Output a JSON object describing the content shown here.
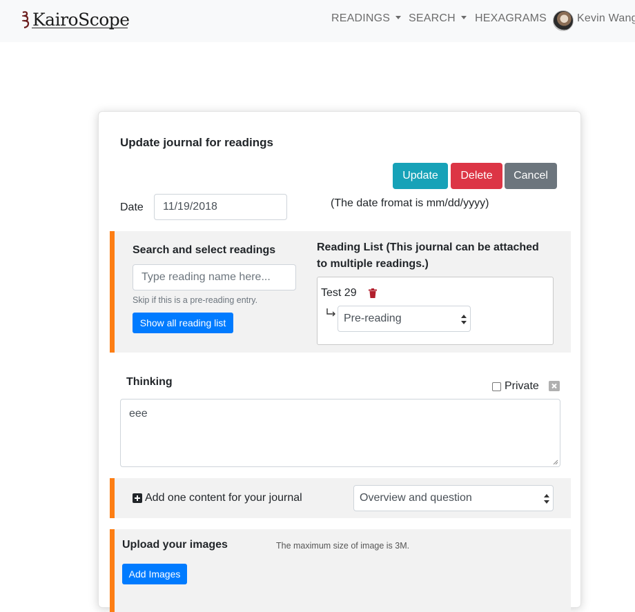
{
  "navbar": {
    "brand": "KairoScope",
    "menu": [
      {
        "label": "READINGS",
        "dropdown": true
      },
      {
        "label": "SEARCH",
        "dropdown": true
      },
      {
        "label": "HEXAGRAMS",
        "dropdown": false
      }
    ],
    "user": {
      "name": "Kevin Wang"
    }
  },
  "form": {
    "title": "Update journal for readings",
    "buttons": {
      "update": "Update",
      "delete": "Delete",
      "cancel": "Cancel"
    },
    "date": {
      "label": "Date",
      "value": "11/19/2018",
      "hint": "(The date fromat is mm/dd/yyyy)"
    },
    "readings": {
      "search_title": "Search and select readings",
      "search_placeholder": "Type reading name here...",
      "skip_hint": "Skip if this is a pre-reading entry.",
      "show_all_label": "Show all reading list",
      "list_title": "Reading List (This journal can be attached to multiple readings.)",
      "items": [
        {
          "name": "Test 29",
          "stage": "Pre-reading"
        }
      ]
    },
    "thinking": {
      "label": "Thinking",
      "private_label": "Private",
      "private_checked": false,
      "text": "eee"
    },
    "add_content": {
      "label": "Add one content for your journal",
      "selected": "Overview and question"
    },
    "upload": {
      "title": "Upload your images",
      "hint": "The maximum size of image is 3M.",
      "button": "Add Images"
    }
  },
  "colors": {
    "accent_orange": "#fd7e14",
    "update": "#17a2b8",
    "delete": "#dc3545",
    "cancel": "#6c757d",
    "primary": "#007bff"
  }
}
